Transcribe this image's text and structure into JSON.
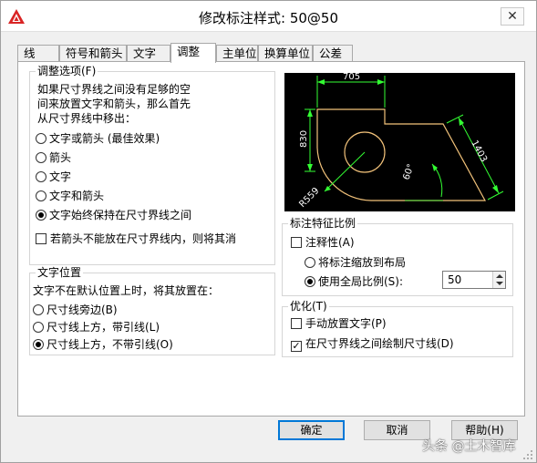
{
  "window": {
    "title": "修改标注样式: 50@50",
    "close_glyph": "✕"
  },
  "tabs": [
    {
      "label": "线"
    },
    {
      "label": "符号和箭头"
    },
    {
      "label": "文字"
    },
    {
      "label": "调整",
      "active": true
    },
    {
      "label": "主单位"
    },
    {
      "label": "换算单位"
    },
    {
      "label": "公差"
    }
  ],
  "fit_options": {
    "title": "调整选项(F)",
    "description": [
      "如果尺寸界线之间没有足够的空",
      "间来放置文字和箭头，那么首先",
      "从尺寸界线中移出："
    ],
    "options": [
      {
        "label": "文字或箭头 (最佳效果)",
        "selected": false
      },
      {
        "label": "箭头",
        "selected": false
      },
      {
        "label": "文字",
        "selected": false
      },
      {
        "label": "文字和箭头",
        "selected": false
      },
      {
        "label": "文字始终保持在尺寸界线之间",
        "selected": true
      }
    ],
    "suppress_arrows": {
      "label": "若箭头不能放在尺寸界线内，则将其消",
      "checked": false
    }
  },
  "text_placement": {
    "title": "文字位置",
    "description": "文字不在默认位置上时，将其放置在：",
    "options": [
      {
        "label": "尺寸线旁边(B)",
        "selected": false
      },
      {
        "label": "尺寸线上方，带引线(L)",
        "selected": false
      },
      {
        "label": "尺寸线上方，不带引线(O)",
        "selected": true
      }
    ]
  },
  "preview": {
    "labels": {
      "top": "705",
      "left": "830",
      "right": "1403",
      "angle": "60°",
      "radius": "R559"
    },
    "colors": {
      "dim": "#33ff33",
      "shape": "#f2c27a",
      "text": "#ffffff",
      "bg": "#000000"
    }
  },
  "scale": {
    "title": "标注特征比例",
    "annotative": {
      "label": "注释性(A)",
      "checked": false
    },
    "options": [
      {
        "label": "将标注缩放到布局",
        "selected": false
      },
      {
        "label": "使用全局比例(S):",
        "selected": true
      }
    ],
    "global_scale_value": "50"
  },
  "fine_tuning": {
    "title": "优化(T)",
    "manual_text": {
      "label": "手动放置文字(P)",
      "checked": false
    },
    "draw_dimline": {
      "label": "在尺寸界线之间绘制尺寸线(D)",
      "checked": true
    }
  },
  "buttons": {
    "ok": "确定",
    "cancel": "取消",
    "help": "帮助(H)"
  },
  "watermark": "头条 @土木智库",
  "icons": {
    "app": "autocad-logo-icon",
    "close": "close-icon"
  },
  "accent": "#0078d7"
}
